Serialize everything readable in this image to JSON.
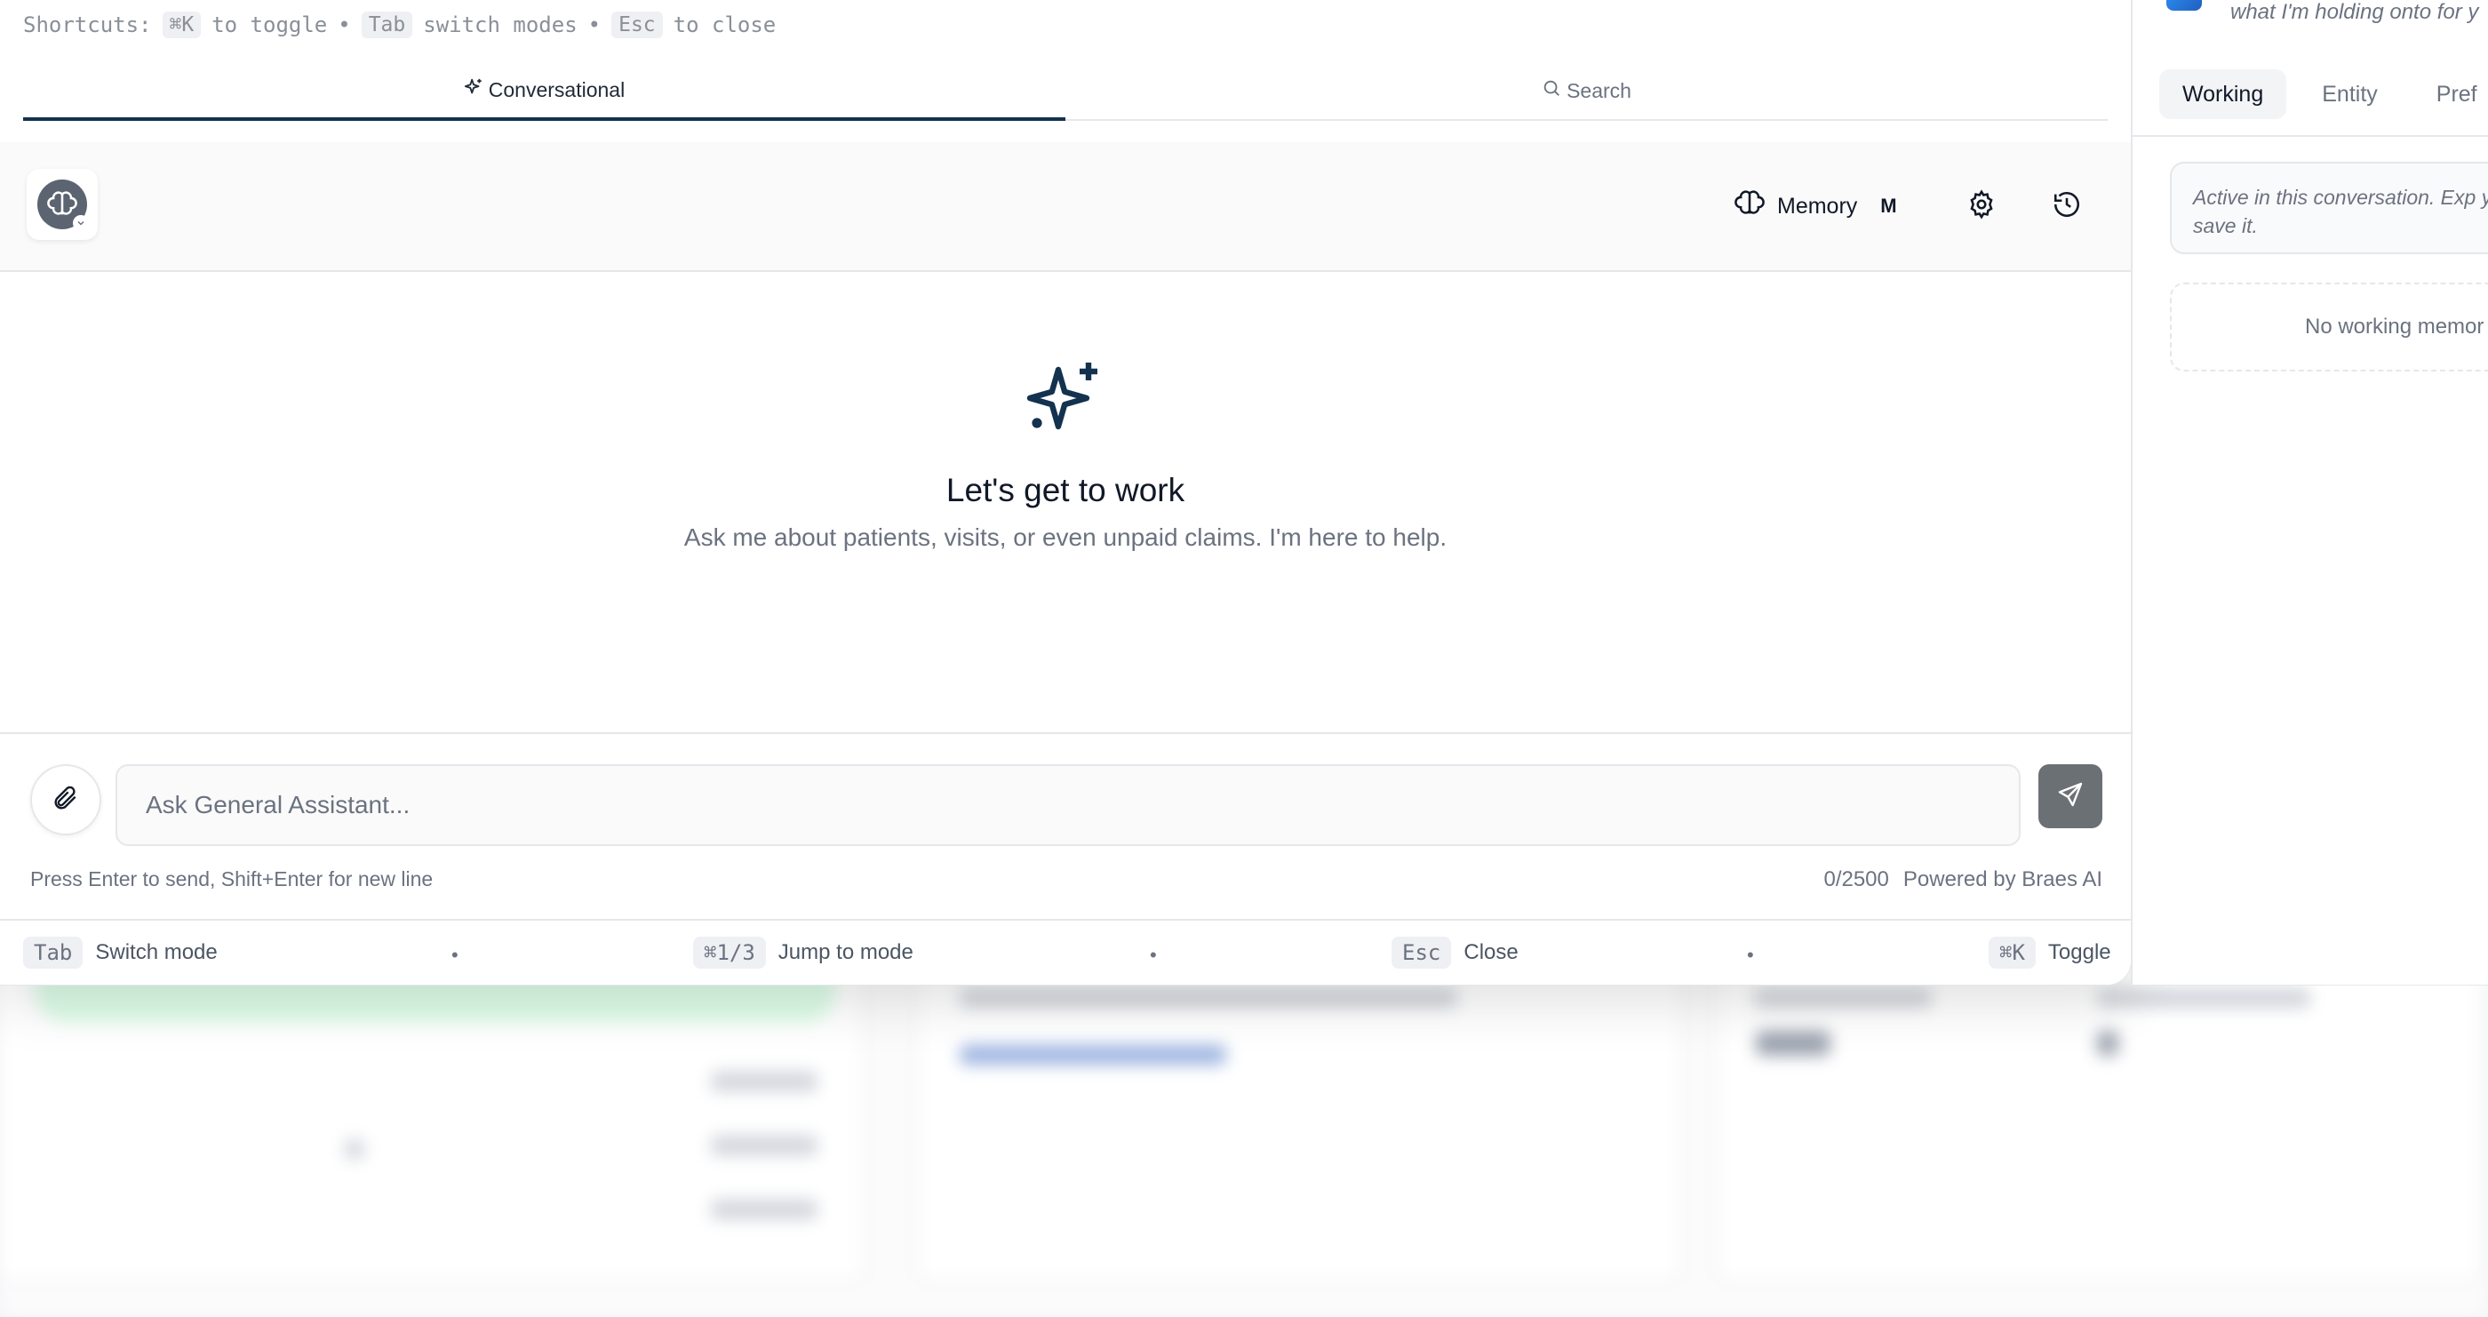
{
  "shortcuts": {
    "label": "Shortcuts:",
    "k1": "⌘K",
    "t1": "to toggle",
    "sep1": "•",
    "k2": "Tab",
    "t2": "switch modes",
    "sep2": "•",
    "k3": "Esc",
    "t3": "to close"
  },
  "tabs": [
    {
      "label": "Conversational",
      "icon": "sparkle-icon",
      "active": true
    },
    {
      "label": "Search",
      "icon": "search-icon",
      "active": false
    }
  ],
  "header": {
    "memory_label": "Memory",
    "memory_shortcut": "M"
  },
  "empty_state": {
    "title": "Let's get to work",
    "subtitle": "Ask me about patients, visits, or even unpaid claims. I'm here to help."
  },
  "composer": {
    "placeholder": "Ask General Assistant...",
    "hint": "Press Enter to send, Shift+Enter for new line",
    "char_count": "0/2500",
    "powered_by": "Powered by Braes AI"
  },
  "footer": {
    "items": [
      {
        "key": "Tab",
        "label": "Switch mode"
      },
      {
        "key": "⌘1/3",
        "label": "Jump to mode"
      },
      {
        "key": "Esc",
        "label": "Close"
      },
      {
        "key": "⌘K",
        "label": "Toggle"
      }
    ],
    "separator": "•"
  },
  "memory_panel": {
    "intro": "what I'm holding onto for y",
    "tabs": [
      {
        "label": "Working",
        "active": true
      },
      {
        "label": "Entity",
        "active": false
      },
      {
        "label": "Pref",
        "active": false
      }
    ],
    "note": "Active in this conversation. Exp you save it.",
    "empty": "No working memor"
  },
  "colors": {
    "accent": "#13324f",
    "send_button": "#6b7075",
    "muted_text": "#6b7280"
  }
}
